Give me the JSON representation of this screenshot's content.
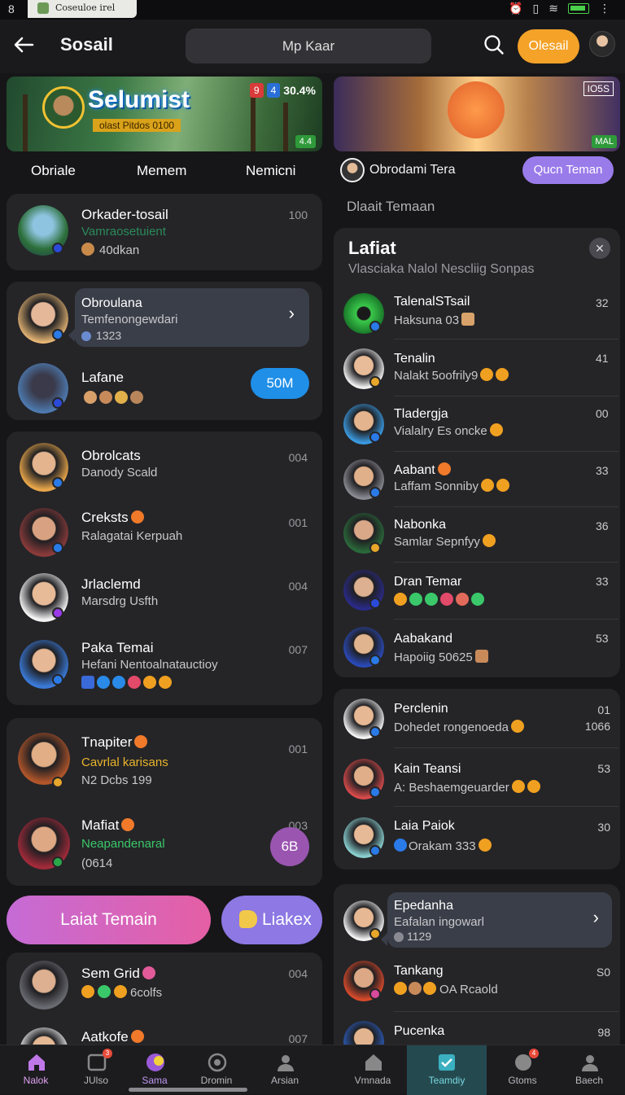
{
  "status_bar": {
    "left_glyph": "8",
    "tab_title": "Coseuloe irel"
  },
  "header": {
    "title": "Sosail",
    "search_text": "Mp Kaar",
    "action_label": "Olesail"
  },
  "left": {
    "banner": {
      "title": "Selumist",
      "subtitle": "olast Pitdos 0100",
      "tag_a": "9",
      "tag_b": "4",
      "rating": "30.4%",
      "badge": "4.4"
    },
    "tabs": [
      "Obriale",
      "Memem",
      "Nemicni"
    ],
    "featured": {
      "name": "Orkader-tosail",
      "sub": "Vamraosetuient",
      "meta": "40dkan",
      "count": "100"
    },
    "group1": [
      {
        "name": "Obroulana",
        "sub": "Temfenongewdari",
        "meta": "1323"
      },
      {
        "name": "Lafane",
        "sub": "",
        "badge": "50M"
      }
    ],
    "group2": [
      {
        "name": "Obrolcats",
        "sub": "Danody Scald",
        "count": "004"
      },
      {
        "name": "Creksts",
        "sub": "Ralagatai Kerpuah",
        "count": "001"
      },
      {
        "name": "Jrlaclemd",
        "sub": "Marsdrg Usfth",
        "count": "004"
      },
      {
        "name": "Paka Temai",
        "sub": "Hefani Nentoalnatauctioy",
        "count": "007"
      }
    ],
    "group3": [
      {
        "name": "Tnapiter",
        "sub": "Cavrlal karisans",
        "sub2": "N2 Dcbs 199",
        "count": "001"
      },
      {
        "name": "Mafiat",
        "sub": "Neapandenaral",
        "sub2": "(0614",
        "count": "003",
        "badge": "6B"
      }
    ],
    "cta_primary": "Laiat Temain",
    "cta_secondary": "Liakex",
    "group4": [
      {
        "name": "Sem Grid",
        "sub": "6colfs",
        "count": "004"
      },
      {
        "name": "Aatkofe",
        "count": "007"
      }
    ]
  },
  "right": {
    "banner": {
      "tag": "IO5S",
      "badge": "MAL"
    },
    "banner_user": "Obrodami Tera",
    "banner_button": "Qucn Teman",
    "section_label": "Dlaait Temaan",
    "panel": {
      "title": "Lafiat",
      "subtitle": "Vlasciaka Nalol Nescliig Sonpas",
      "items": [
        {
          "name": "TalenalSTsail",
          "sub": "Haksuna 03",
          "count": "32"
        },
        {
          "name": "Tenalin",
          "sub": "Nalakt 5oofrily9",
          "count": "41"
        },
        {
          "name": "Tladergja",
          "sub": "Vialalry Es oncke",
          "count": "00"
        },
        {
          "name": "Aabant",
          "sub": "Laffam Sonniby",
          "count": "33"
        },
        {
          "name": "Nabonka",
          "sub": "Samlar Sepnfyy",
          "count": "36"
        },
        {
          "name": "Dran Temar",
          "sub": "",
          "count": "33"
        },
        {
          "name": "Aabakand",
          "sub": "Hapoiig 50625",
          "count": "53"
        }
      ]
    },
    "panel2": [
      {
        "name": "Perclenin",
        "sub": "Dohedet rongenoeda",
        "count": "01",
        "count2": "1066"
      },
      {
        "name": "Kain Teansi",
        "sub": "A: Beshaemgeuarder",
        "count": "53"
      },
      {
        "name": "Laia Paiok",
        "sub": "Orakam 333",
        "count": "30"
      }
    ],
    "panel3": [
      {
        "name": "Epedanha",
        "sub": "Eafalan ingowarl",
        "meta": "1129"
      },
      {
        "name": "Tankang",
        "sub": "OA Rcaold",
        "count": "S0"
      },
      {
        "name": "Pucenka",
        "count": "98"
      }
    ]
  },
  "nav": [
    {
      "label": "Nalok",
      "icon": "home-icon"
    },
    {
      "label": "JUlso",
      "icon": "inbox-icon",
      "badge": "3"
    },
    {
      "label": "Sama",
      "icon": "palette-icon"
    },
    {
      "label": "Dromin",
      "icon": "clock-icon"
    },
    {
      "label": "Arsian",
      "icon": "person-icon"
    },
    {
      "label": "Vmnada",
      "icon": "house-icon"
    },
    {
      "label": "Teamdiy",
      "icon": "check-square-icon"
    },
    {
      "label": "Gtoms",
      "icon": "chat-icon",
      "badge": "4"
    },
    {
      "label": "Baech",
      "icon": "person-icon"
    }
  ],
  "colors": {
    "accent_orange": "#f4a228",
    "accent_purple": "#9a7bea",
    "accent_blue": "#1f8fe8",
    "active_nav": "#244a50"
  }
}
